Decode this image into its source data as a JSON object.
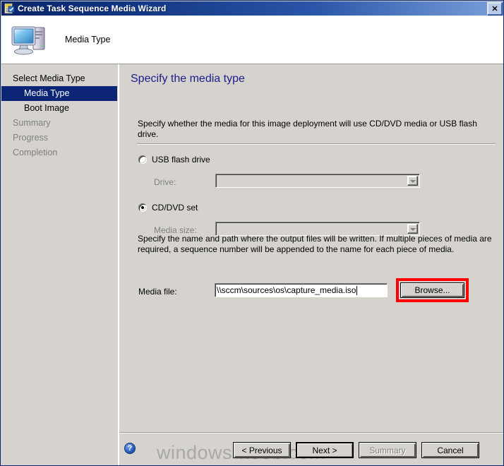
{
  "window": {
    "title": "Create Task Sequence Media Wizard",
    "title_icon": "wizard-document-icon",
    "close_label": "✕"
  },
  "header": {
    "icon": "computer-icon",
    "title": "Media Type"
  },
  "sidebar": {
    "items": [
      {
        "label": "Select Media Type",
        "state": "normal",
        "level": 0
      },
      {
        "label": "Media Type",
        "state": "selected",
        "level": 1
      },
      {
        "label": "Boot Image",
        "state": "normal",
        "level": 1
      },
      {
        "label": "Summary",
        "state": "disabled",
        "level": 0
      },
      {
        "label": "Progress",
        "state": "disabled",
        "level": 0
      },
      {
        "label": "Completion",
        "state": "disabled",
        "level": 0
      }
    ]
  },
  "content": {
    "heading": "Specify the media type",
    "intro": "Specify whether the media for this image deployment will use CD/DVD media or USB flash drive.",
    "radios": [
      {
        "label": "USB flash drive",
        "checked": false
      },
      {
        "label": "CD/DVD set",
        "checked": true
      }
    ],
    "drive": {
      "label": "Drive:",
      "value": "",
      "enabled": false
    },
    "media_size": {
      "label": "Media size:",
      "value": "",
      "enabled": false
    },
    "description": "Specify the name and path where the output files will be written.  If multiple pieces of media are required, a sequence number will be appended to the name for each piece of media.",
    "media_file": {
      "label": "Media file:",
      "value": "\\\\sccm\\sources\\os\\capture_media.iso",
      "focused": true
    },
    "browse_label": "Browse...",
    "browse_highlight_color": "#ff0000"
  },
  "footer": {
    "help_icon": "help-question-icon",
    "watermark": "windows-noob.com",
    "buttons": [
      {
        "label": "< Previous",
        "state": "enabled"
      },
      {
        "label": "Next >",
        "state": "default"
      },
      {
        "label": "Summary",
        "state": "disabled"
      },
      {
        "label": "Cancel",
        "state": "enabled"
      }
    ]
  },
  "colors": {
    "title_start": "#0a246a",
    "title_end": "#7ba0db",
    "dialog_face": "#d6d3ce",
    "heading": "#1c1c8c",
    "selection": "#0c2577",
    "highlight": "#ff0000"
  }
}
